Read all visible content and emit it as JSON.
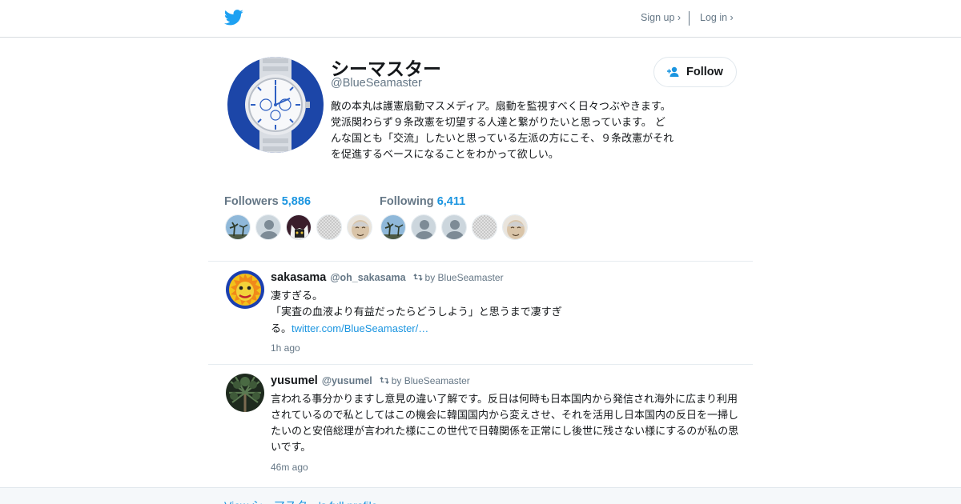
{
  "nav": {
    "signup": "Sign up ›",
    "login": "Log in ›"
  },
  "profile": {
    "name": "シーマスター",
    "handle": "@BlueSeamaster",
    "bio": "敵の本丸は護憲扇動マスメディア。扇動を監視すべく日々つぶやきます。 党派関わらず９条改憲を切望する人達と繋がりたいと思っています。 どんな国とも「交流」したいと思っている左派の方にこそ、９条改憲がそれを促進するベースになることをわかって欲しい。",
    "follow_label": "Follow"
  },
  "stats": {
    "followers_label": "Followers",
    "followers_count": "5,886",
    "following_label": "Following",
    "following_count": "6,411"
  },
  "tweets": [
    {
      "name": "sakasama",
      "handle": "@oh_sakasama",
      "retweeted_by": "by BlueSeamaster",
      "line1": "凄すぎる。",
      "line2": "「実査の血液より有益だったらどうしよう」と思うまで凄すぎ",
      "line3": "る。",
      "link": "twitter.com/BlueSeamaster/…",
      "time": "1h ago"
    },
    {
      "name": "yusumel",
      "handle": "@yusumel",
      "retweeted_by": "by BlueSeamaster",
      "text": "言われる事分かりますし意見の違い了解です。反日は何時も日本国内から発信され海外に広まり利用されているので私としてはこの機会に韓国国内から変えさせ、それを活用し日本国内の反日を一掃したいのと安倍総理が言われた様にこの世代で日韓関係を正常にし後世に残さない様にするのが私の思いです。",
      "time": "46m ago"
    }
  ],
  "footer": {
    "link": "View シーマスター's full profile →"
  },
  "colors": {
    "accent": "#1b95e0",
    "muted": "#657786",
    "text": "#14171a",
    "border": "#e6ecf0",
    "twitter_blue": "#1da1f2"
  },
  "icons": {
    "logo": "twitter-bird-icon",
    "follow": "follow-person-plus-icon",
    "retweet": "retweet-icon"
  }
}
